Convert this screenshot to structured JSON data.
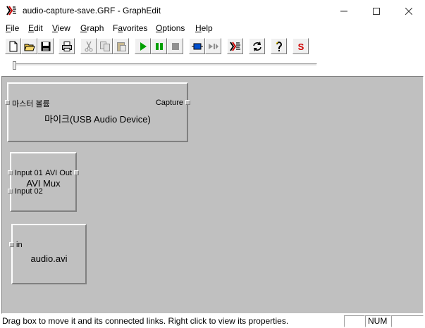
{
  "window": {
    "title": "audio-capture-save.GRF - GraphEdit",
    "app_icon": "graphedit-icon",
    "controls": [
      "minimize-icon",
      "maximize-icon",
      "close-icon"
    ]
  },
  "menu": {
    "items": [
      {
        "accel": "F",
        "rest": "ile"
      },
      {
        "accel": "E",
        "rest": "dit"
      },
      {
        "accel": "V",
        "rest": "iew"
      },
      {
        "accel": "G",
        "rest": "raph"
      },
      {
        "accel": "",
        "pre": "F",
        "accel2": "a",
        "rest": "vorites"
      },
      {
        "accel": "O",
        "rest": "ptions"
      },
      {
        "accel": "H",
        "rest": "elp"
      }
    ]
  },
  "toolbar": {
    "buttons": [
      "new-icon",
      "open-icon",
      "save-icon",
      "print-icon",
      "cut-icon",
      "copy-icon",
      "paste-icon",
      "play-icon",
      "pause-icon",
      "stop-icon",
      "seek-icon",
      "step-icon",
      "graphedit-icon",
      "refresh-icon",
      "help-icon",
      "s-icon"
    ],
    "colors": {
      "play": "#00a000",
      "pause": "#00a000",
      "s": "#d00000",
      "seek": "#0050d0"
    }
  },
  "seek_position": 0,
  "filters": {
    "mic": {
      "name": "마이크(USB Audio Device)",
      "input_pin": "마스터 볼륨",
      "output_pin": "Capture"
    },
    "avimux": {
      "name": "AVI Mux",
      "input_pin_1": "Input 01",
      "input_pin_2": "Input 02",
      "output_pin": "AVI Out"
    },
    "filewriter": {
      "name": "audio.avi",
      "input_pin": "in"
    }
  },
  "status": {
    "message": "Drag box to move it and its connected links. Right click to view its properties.",
    "num": "NUM"
  }
}
